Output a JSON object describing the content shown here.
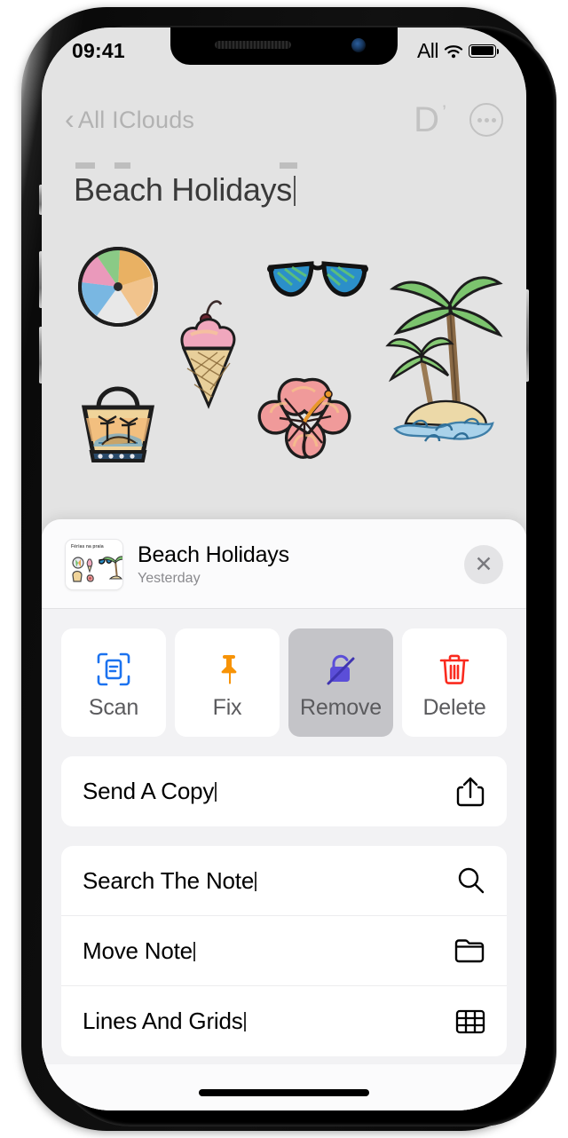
{
  "status_bar": {
    "time": "09:41",
    "signal_label": "All",
    "wifi_icon": "wifi-icon",
    "battery_icon": "battery-full-icon"
  },
  "nav_bar": {
    "back_label": "All IClouds",
    "back_icon": "chevron-left-icon",
    "markup_icon": "markup-pen-icon",
    "more_icon": "more-ellipsis-icon"
  },
  "note": {
    "title": "Beach Holidays",
    "stickers": [
      {
        "name": "beach-ball-sticker"
      },
      {
        "name": "ice-cream-cone-sticker"
      },
      {
        "name": "sunglasses-sticker"
      },
      {
        "name": "palm-tree-island-sticker"
      },
      {
        "name": "beach-bag-sticker"
      },
      {
        "name": "hibiscus-flower-sticker"
      }
    ]
  },
  "share_sheet": {
    "thumbnail_caption": "Férias na praia",
    "title": "Beach Holidays",
    "subtitle": "Yesterday",
    "close_icon": "close-x-icon",
    "actions": [
      {
        "label": "Scan",
        "icon": "scan-document-icon",
        "color": "#1b72ef",
        "pressed": false
      },
      {
        "label": "Fix",
        "icon": "pin-icon",
        "color": "#f79307",
        "pressed": false
      },
      {
        "label": "Remove",
        "icon": "lock-slash-icon",
        "color": "#5b4ed8",
        "pressed": true
      },
      {
        "label": "Delete",
        "icon": "trash-icon",
        "color": "#fa2a1e",
        "pressed": false
      }
    ],
    "groups": [
      {
        "rows": [
          {
            "label": "Send A Copy",
            "icon": "share-up-icon"
          }
        ]
      },
      {
        "rows": [
          {
            "label": "Search The Note",
            "icon": "search-icon"
          },
          {
            "label": "Move Note",
            "icon": "folder-icon"
          },
          {
            "label": "Lines And Grids",
            "icon": "grid-table-icon"
          }
        ]
      }
    ]
  },
  "colors": {
    "sheet_background": "#f2f2f4",
    "note_background": "#e3e3e3",
    "pressed_tile": "#c4c4c8"
  }
}
